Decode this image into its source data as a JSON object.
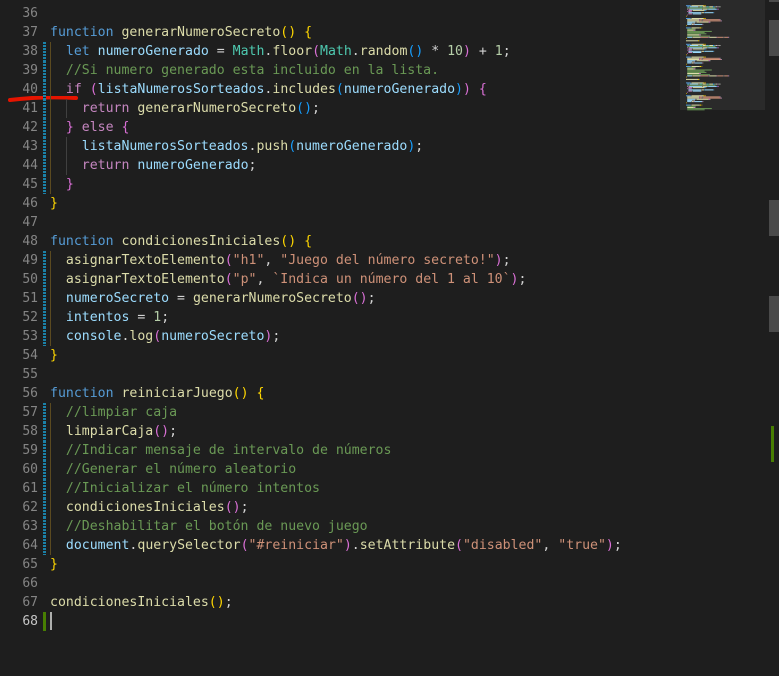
{
  "editor": {
    "lines": [
      {
        "n": "36",
        "tokens": []
      },
      {
        "n": "37",
        "tokens": [
          [
            "kw",
            "function"
          ],
          [
            "pu",
            " "
          ],
          [
            "fn",
            "generarNumeroSecreto"
          ],
          [
            "b1",
            "()"
          ],
          [
            "pu",
            " "
          ],
          [
            "b1",
            "{"
          ]
        ]
      },
      {
        "n": "38",
        "tokens": [
          [
            "pu",
            "  "
          ],
          [
            "kw",
            "let"
          ],
          [
            "pu",
            " "
          ],
          [
            "var",
            "numeroGenerado"
          ],
          [
            "pu",
            " = "
          ],
          [
            "obj",
            "Math"
          ],
          [
            "pu",
            "."
          ],
          [
            "fn",
            "floor"
          ],
          [
            "b2",
            "("
          ],
          [
            "obj",
            "Math"
          ],
          [
            "pu",
            "."
          ],
          [
            "fn",
            "random"
          ],
          [
            "b3",
            "()"
          ],
          [
            "pu",
            " * "
          ],
          [
            "num",
            "10"
          ],
          [
            "b2",
            ")"
          ],
          [
            "pu",
            " + "
          ],
          [
            "num",
            "1"
          ],
          [
            "pu",
            ";"
          ]
        ]
      },
      {
        "n": "39",
        "tokens": [
          [
            "pu",
            "  "
          ],
          [
            "cmt",
            "//Si numero generado esta incluido en la lista."
          ]
        ]
      },
      {
        "n": "40",
        "tokens": [
          [
            "pu",
            "  "
          ],
          [
            "ctrl",
            "if"
          ],
          [
            "pu",
            " "
          ],
          [
            "b2",
            "("
          ],
          [
            "var",
            "listaNumerosSorteados"
          ],
          [
            "pu",
            "."
          ],
          [
            "fn",
            "includes"
          ],
          [
            "b3",
            "("
          ],
          [
            "var",
            "numeroGenerado"
          ],
          [
            "b3",
            ")"
          ],
          [
            "b2",
            ")"
          ],
          [
            "pu",
            " "
          ],
          [
            "b2",
            "{"
          ]
        ]
      },
      {
        "n": "41",
        "tokens": [
          [
            "pu",
            "    "
          ],
          [
            "ctrl",
            "return"
          ],
          [
            "pu",
            " "
          ],
          [
            "fn",
            "generarNumeroSecreto"
          ],
          [
            "b3",
            "()"
          ],
          [
            "pu",
            ";"
          ]
        ]
      },
      {
        "n": "42",
        "tokens": [
          [
            "pu",
            "  "
          ],
          [
            "b2",
            "}"
          ],
          [
            "pu",
            " "
          ],
          [
            "ctrl",
            "else"
          ],
          [
            "pu",
            " "
          ],
          [
            "b2",
            "{"
          ]
        ]
      },
      {
        "n": "43",
        "tokens": [
          [
            "pu",
            "    "
          ],
          [
            "var",
            "listaNumerosSorteados"
          ],
          [
            "pu",
            "."
          ],
          [
            "fn",
            "push"
          ],
          [
            "b3",
            "("
          ],
          [
            "var",
            "numeroGenerado"
          ],
          [
            "b3",
            ")"
          ],
          [
            "pu",
            ";"
          ]
        ]
      },
      {
        "n": "44",
        "tokens": [
          [
            "pu",
            "    "
          ],
          [
            "ctrl",
            "return"
          ],
          [
            "pu",
            " "
          ],
          [
            "var",
            "numeroGenerado"
          ],
          [
            "pu",
            ";"
          ]
        ]
      },
      {
        "n": "45",
        "tokens": [
          [
            "pu",
            "  "
          ],
          [
            "b2",
            "}"
          ]
        ]
      },
      {
        "n": "46",
        "tokens": [
          [
            "b1",
            "}"
          ]
        ]
      },
      {
        "n": "47",
        "tokens": []
      },
      {
        "n": "48",
        "tokens": [
          [
            "kw",
            "function"
          ],
          [
            "pu",
            " "
          ],
          [
            "fn",
            "condicionesIniciales"
          ],
          [
            "b1",
            "()"
          ],
          [
            "pu",
            " "
          ],
          [
            "b1",
            "{"
          ]
        ]
      },
      {
        "n": "49",
        "tokens": [
          [
            "pu",
            "  "
          ],
          [
            "fn",
            "asignarTextoElemento"
          ],
          [
            "b2",
            "("
          ],
          [
            "str",
            "\"h1\""
          ],
          [
            "pu",
            ", "
          ],
          [
            "str",
            "\"Juego del número secreto!\""
          ],
          [
            "b2",
            ")"
          ],
          [
            "pu",
            ";"
          ]
        ]
      },
      {
        "n": "50",
        "tokens": [
          [
            "pu",
            "  "
          ],
          [
            "fn",
            "asignarTextoElemento"
          ],
          [
            "b2",
            "("
          ],
          [
            "str",
            "\"p\""
          ],
          [
            "pu",
            ", "
          ],
          [
            "str",
            "`Indica un número del 1 al 10`"
          ],
          [
            "b2",
            ")"
          ],
          [
            "pu",
            ";"
          ]
        ]
      },
      {
        "n": "51",
        "tokens": [
          [
            "pu",
            "  "
          ],
          [
            "var",
            "numeroSecreto"
          ],
          [
            "pu",
            " = "
          ],
          [
            "fn",
            "generarNumeroSecreto"
          ],
          [
            "b2",
            "()"
          ],
          [
            "pu",
            ";"
          ]
        ]
      },
      {
        "n": "52",
        "tokens": [
          [
            "pu",
            "  "
          ],
          [
            "var",
            "intentos"
          ],
          [
            "pu",
            " = "
          ],
          [
            "num",
            "1"
          ],
          [
            "pu",
            ";"
          ]
        ]
      },
      {
        "n": "53",
        "tokens": [
          [
            "pu",
            "  "
          ],
          [
            "var",
            "console"
          ],
          [
            "pu",
            "."
          ],
          [
            "fn",
            "log"
          ],
          [
            "b2",
            "("
          ],
          [
            "var",
            "numeroSecreto"
          ],
          [
            "b2",
            ")"
          ],
          [
            "pu",
            ";"
          ]
        ]
      },
      {
        "n": "54",
        "tokens": [
          [
            "b1",
            "}"
          ]
        ]
      },
      {
        "n": "55",
        "tokens": []
      },
      {
        "n": "56",
        "tokens": [
          [
            "kw",
            "function"
          ],
          [
            "pu",
            " "
          ],
          [
            "fn",
            "reiniciarJuego"
          ],
          [
            "b1",
            "()"
          ],
          [
            "pu",
            " "
          ],
          [
            "b1",
            "{"
          ]
        ]
      },
      {
        "n": "57",
        "tokens": [
          [
            "pu",
            "  "
          ],
          [
            "cmt",
            "//limpiar caja"
          ]
        ]
      },
      {
        "n": "58",
        "tokens": [
          [
            "pu",
            "  "
          ],
          [
            "fn",
            "limpiarCaja"
          ],
          [
            "b2",
            "()"
          ],
          [
            "pu",
            ";"
          ]
        ]
      },
      {
        "n": "59",
        "tokens": [
          [
            "pu",
            "  "
          ],
          [
            "cmt",
            "//Indicar mensaje de intervalo de números"
          ]
        ]
      },
      {
        "n": "60",
        "tokens": [
          [
            "pu",
            "  "
          ],
          [
            "cmt",
            "//Generar el número aleatorio"
          ]
        ]
      },
      {
        "n": "61",
        "tokens": [
          [
            "pu",
            "  "
          ],
          [
            "cmt",
            "//Inicializar el número intentos"
          ]
        ]
      },
      {
        "n": "62",
        "tokens": [
          [
            "pu",
            "  "
          ],
          [
            "fn",
            "condicionesIniciales"
          ],
          [
            "b2",
            "()"
          ],
          [
            "pu",
            ";"
          ]
        ]
      },
      {
        "n": "63",
        "tokens": [
          [
            "pu",
            "  "
          ],
          [
            "cmt",
            "//Deshabilitar el botón de nuevo juego"
          ]
        ]
      },
      {
        "n": "64",
        "tokens": [
          [
            "pu",
            "  "
          ],
          [
            "var",
            "document"
          ],
          [
            "pu",
            "."
          ],
          [
            "fn",
            "querySelector"
          ],
          [
            "b2",
            "("
          ],
          [
            "str",
            "\"#reiniciar\""
          ],
          [
            "b2",
            ")"
          ],
          [
            "pu",
            "."
          ],
          [
            "fn",
            "setAttribute"
          ],
          [
            "b2",
            "("
          ],
          [
            "str",
            "\"disabled\""
          ],
          [
            "pu",
            ", "
          ],
          [
            "str",
            "\"true\""
          ],
          [
            "b2",
            ")"
          ],
          [
            "pu",
            ";"
          ]
        ]
      },
      {
        "n": "65",
        "tokens": [
          [
            "b1",
            "}"
          ]
        ]
      },
      {
        "n": "66",
        "tokens": []
      },
      {
        "n": "67",
        "tokens": [
          [
            "fn",
            "condicionesIniciales"
          ],
          [
            "b1",
            "()"
          ],
          [
            "pu",
            ";"
          ]
        ]
      },
      {
        "n": "68",
        "tokens": []
      }
    ],
    "active_line": "68",
    "modified_lines": [
      "38",
      "39",
      "40",
      "41",
      "42",
      "43",
      "44",
      "45",
      "49",
      "50",
      "51",
      "52",
      "53",
      "57",
      "58",
      "59",
      "60",
      "61",
      "62",
      "63",
      "64"
    ],
    "added_lines": [
      "68"
    ]
  },
  "colors": {
    "background": "#1e1e1e",
    "keyword": "#569cd6",
    "control": "#c586c0",
    "function": "#dcdcaa",
    "variable": "#9cdcfe",
    "string": "#ce9178",
    "number": "#b5cea8",
    "comment": "#6a9955",
    "annotation": "#e51400"
  }
}
